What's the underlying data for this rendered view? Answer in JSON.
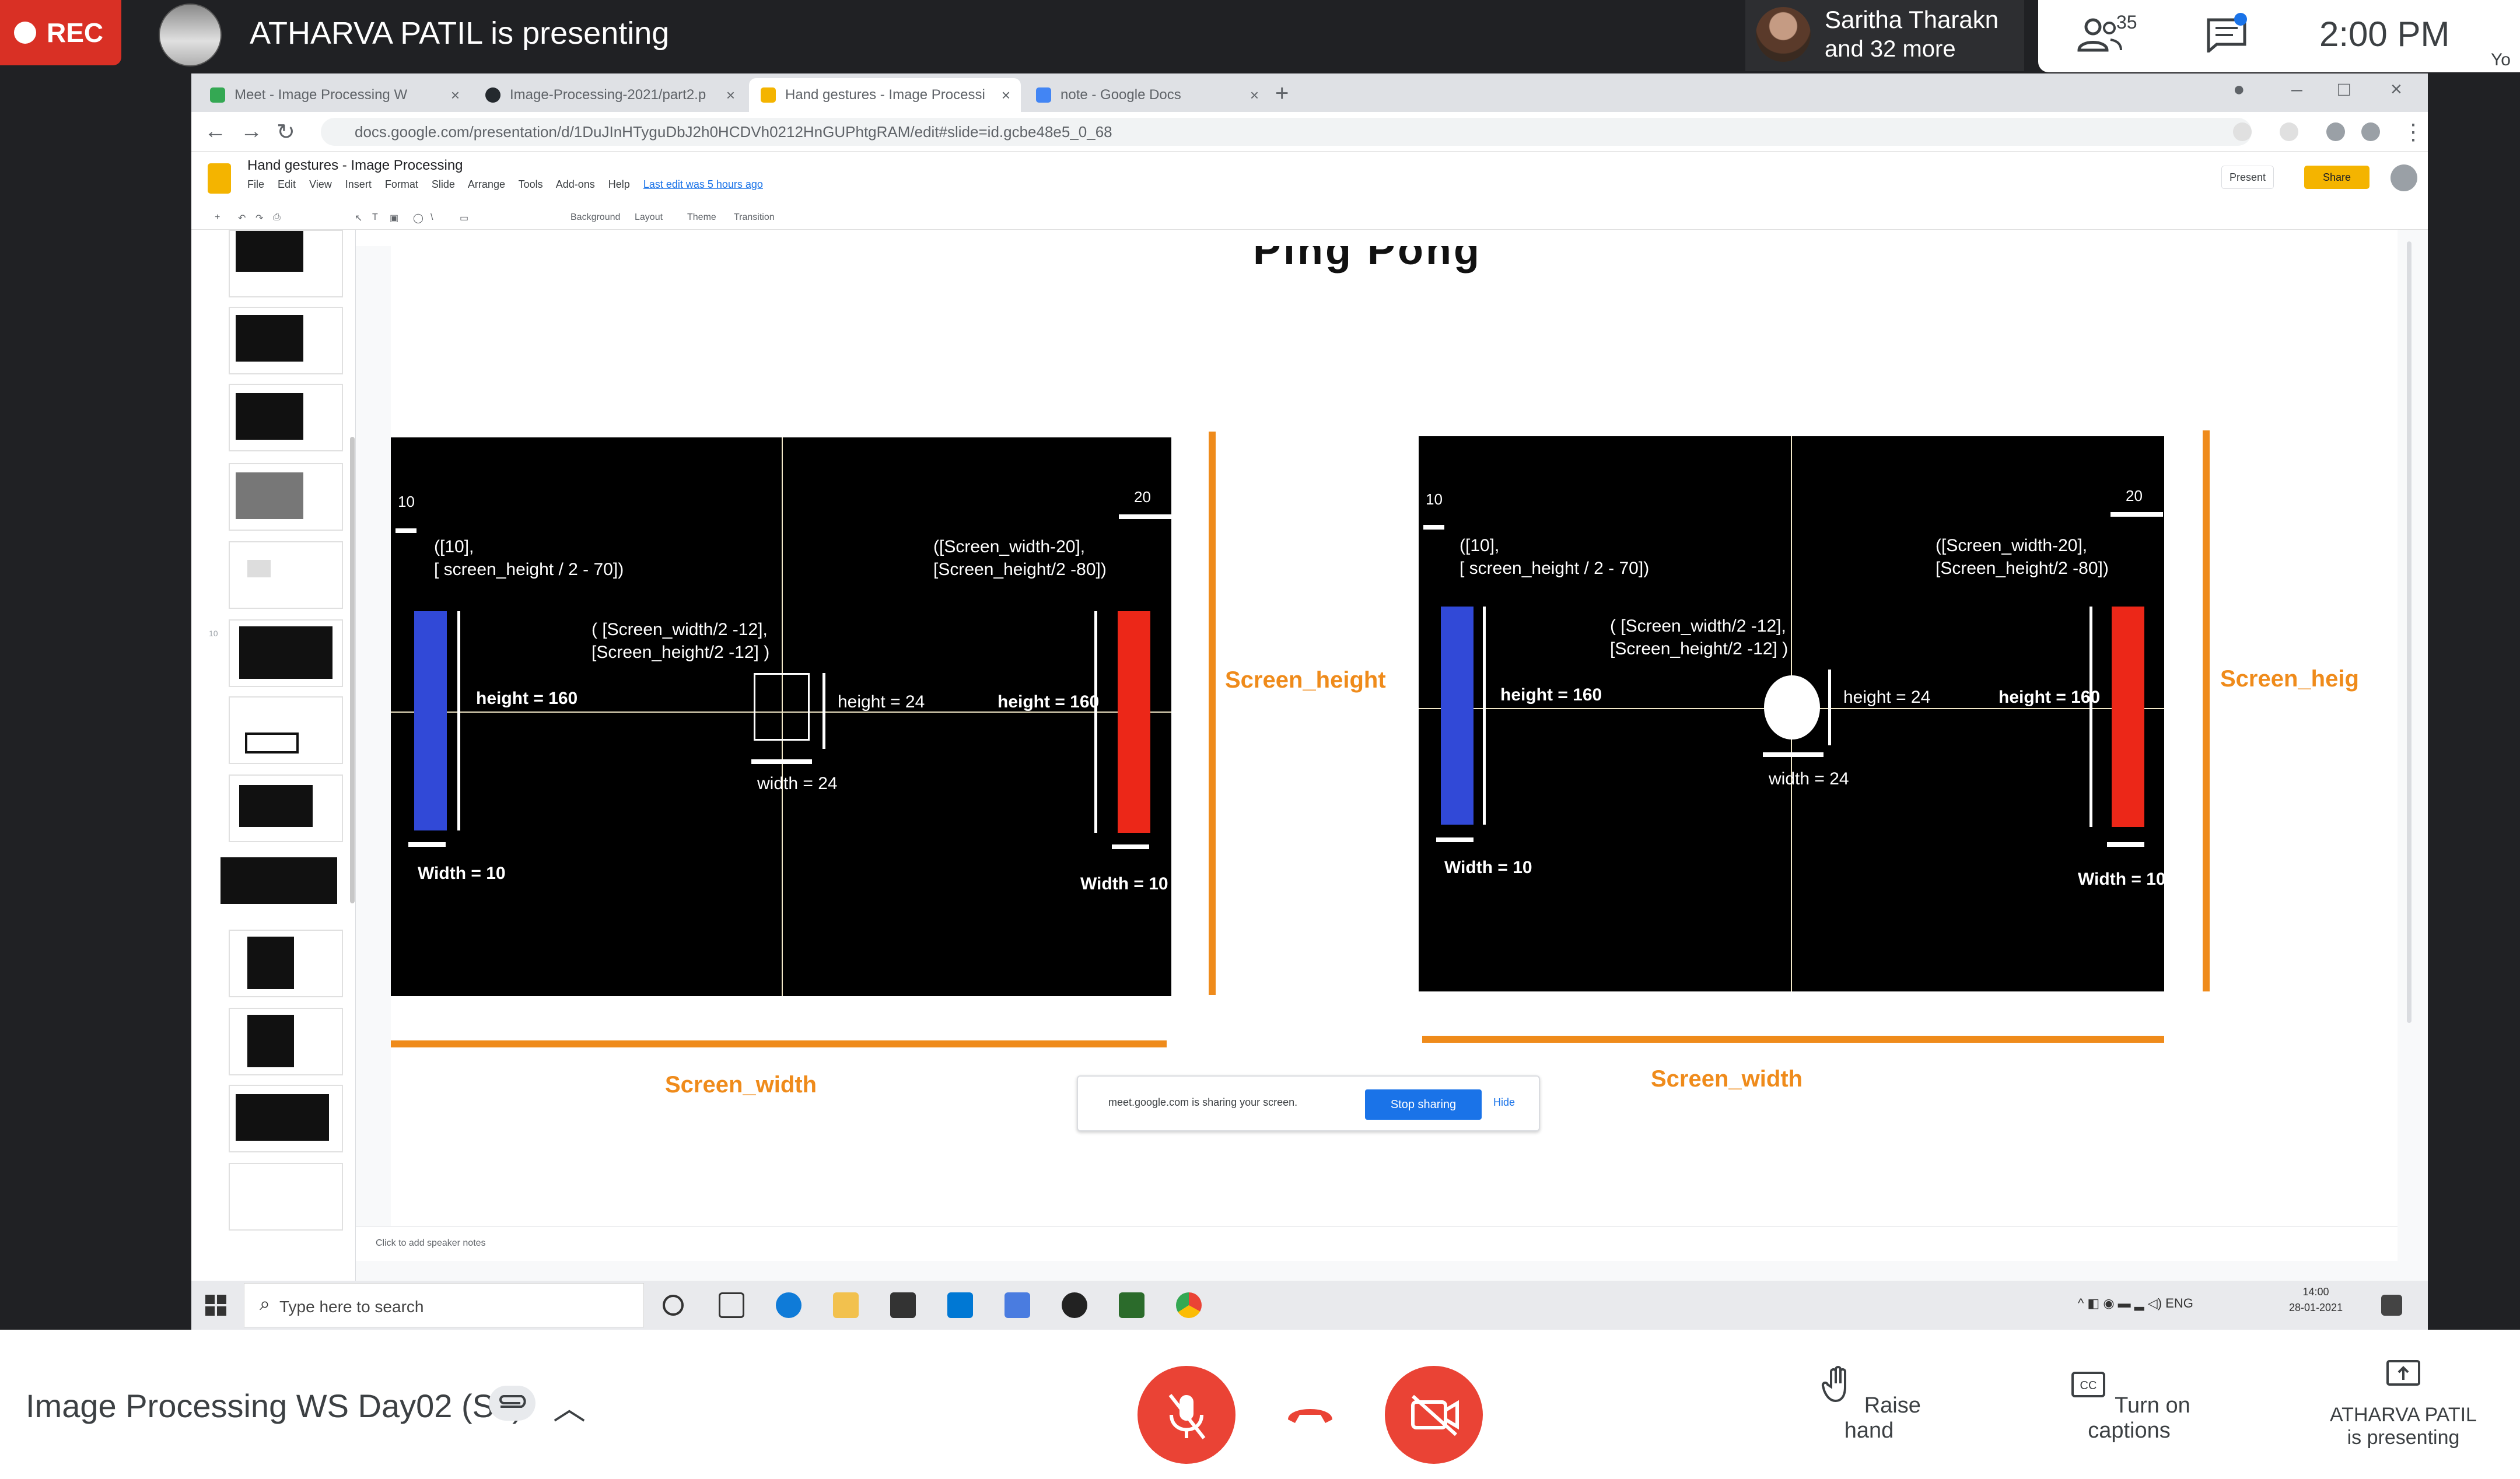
{
  "meet": {
    "rec_label": "REC",
    "presenting_title": "ATHARVA PATIL is presenting",
    "participant_name": "Saritha Tharakn",
    "participant_more": "and 32 more",
    "people_count": "35",
    "clock": "2:00 PM",
    "you_label": "Yo",
    "meeting_name": "Image Processing WS Day02 (S1)",
    "raise_hand": "Raise hand",
    "captions": "Turn on captions",
    "presenter_line1": "ATHARVA PATIL",
    "presenter_line2": "is presenting"
  },
  "browser": {
    "tabs": [
      {
        "label": "Meet - Image Processing W"
      },
      {
        "label": "Image-Processing-2021/part2.p"
      },
      {
        "label": "Hand gestures - Image Processi"
      },
      {
        "label": "note - Google Docs"
      }
    ],
    "url": "docs.google.com/presentation/d/1DuJInHTyguDbJ2h0HCDVh0212HnGUPhtgRAM/edit#slide=id.gcbe48e5_0_68"
  },
  "slides_app": {
    "doc_title": "Hand gestures - Image Processing",
    "menu": [
      "File",
      "Edit",
      "View",
      "Insert",
      "Format",
      "Slide",
      "Arrange",
      "Tools",
      "Add-ons",
      "Help"
    ],
    "last_edit": "Last edit was 5 hours ago",
    "present_label": "Present",
    "share_label": "Share",
    "toolbar_items": [
      "Background",
      "Layout",
      "Theme",
      "Transition"
    ],
    "notes_placeholder": "Click to add speaker notes",
    "share_notice_text": "meet.google.com is sharing your screen.",
    "stop_sharing": "Stop sharing",
    "hide": "Hide"
  },
  "slide": {
    "title": "Ping Pong",
    "left_panel": {
      "corner_left": "10",
      "corner_right": "20",
      "ann_left_pos": "([10],\n[ screen_height / 2 - 70])",
      "ann_right_pos": "([Screen_width-20],\n[Screen_height/2 -80])",
      "ann_center_pos": "( [Screen_width/2 -12],\n[Screen_height/2 -12] )",
      "left_height": "height = 160",
      "center_height": "height = 24",
      "right_height": "height = 160",
      "center_width": "width = 24",
      "left_width": "Width = 10",
      "right_width": "Width = 10"
    },
    "right_panel": {
      "corner_left": "10",
      "corner_right": "20",
      "ann_left_pos": "([10],\n[ screen_height / 2 - 70])",
      "ann_right_pos": "([Screen_width-20],\n[Screen_height/2 -80])",
      "ann_center_pos": "( [Screen_width/2 -12],\n[Screen_height/2 -12] )",
      "left_height": "height = 160",
      "center_height": "height = 24",
      "right_height": "height = 160",
      "center_width": "width = 24",
      "left_width": "Width = 10",
      "right_width": "Width = 10"
    },
    "screen_height_label": "Screen_height",
    "screen_height_label_cut": "Screen_heig",
    "screen_width_label": "Screen_width"
  },
  "taskbar": {
    "search_placeholder": "Type here to search",
    "date_time": "14:00\n28-01-2021"
  },
  "colors": {
    "meet_red": "#ea4335",
    "paddle_blue": "#3149d7",
    "paddle_red": "#ec2718",
    "annotation_orange": "#ef8b1b",
    "slides_yellow": "#f4b400"
  }
}
